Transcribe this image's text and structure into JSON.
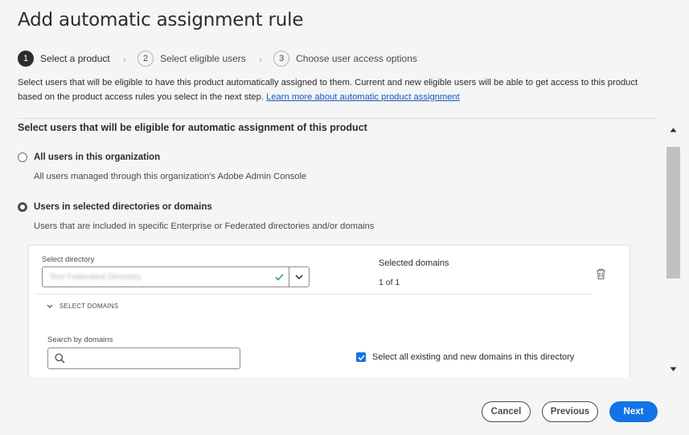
{
  "title": "Add automatic assignment rule",
  "steps": [
    {
      "num": "1",
      "label": "Select a product"
    },
    {
      "num": "2",
      "label": "Select eligible users"
    },
    {
      "num": "3",
      "label": "Choose user access options"
    }
  ],
  "step_separator": "›",
  "description": {
    "text": "Select users that will be eligible to have this product automatically assigned to them. Current and new eligible users will be able to get access to this product based on the product access rules you select in the next step. ",
    "link": "Learn more about automatic product assignment"
  },
  "section": {
    "heading": "Select users that will be eligible for automatic assignment of this product",
    "option_all": {
      "label": "All users in this organization",
      "sub": "All users managed through this organization's Adobe Admin Console"
    },
    "option_selected": {
      "label": "Users in selected directories or domains",
      "sub": "Users that are included in specific Enterprise or Federated directories and/or domains"
    }
  },
  "directory_card": {
    "select_label": "Select directory",
    "select_value": "Test Federated Directory",
    "selected_domains_title": "Selected domains",
    "selected_domains_count": "1 of 1",
    "collapse_label": "SELECT DOMAINS",
    "search_label": "Search by domains",
    "search_placeholder": "",
    "checkbox_label": "Select all existing and new domains in this directory"
  },
  "footer": {
    "cancel": "Cancel",
    "previous": "Previous",
    "next": "Next"
  },
  "colors": {
    "accent": "#1473e6",
    "link": "#1857c4",
    "success": "#2d9d78"
  }
}
